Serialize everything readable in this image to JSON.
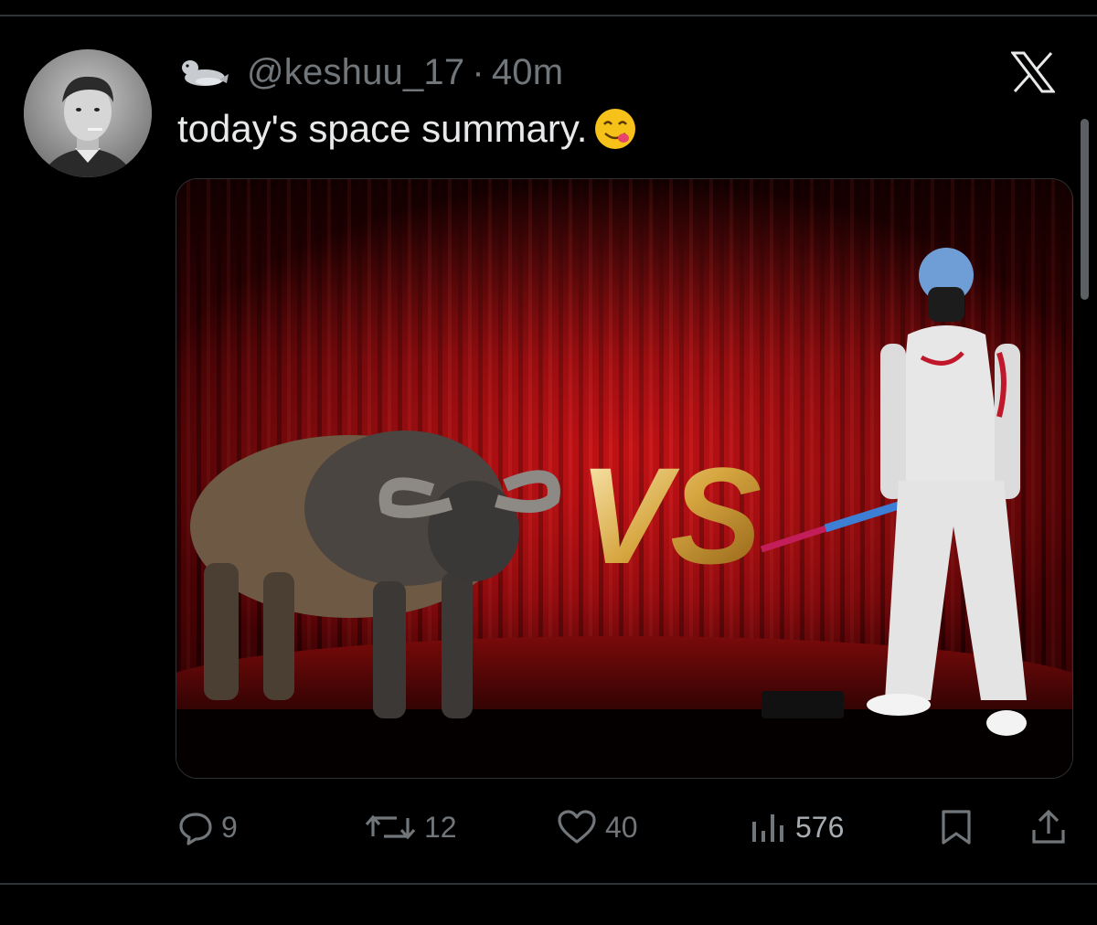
{
  "tweet": {
    "handle": "@keshuu_17",
    "separator": "·",
    "time": "40m",
    "text": "today's space summary.",
    "badge_icon": "seal-emoji-icon",
    "emoji_icon": "face-savoring-food-emoji-icon"
  },
  "media": {
    "vs_text": "VS"
  },
  "actions": {
    "replies": "9",
    "retweets": "12",
    "likes": "40",
    "views": "576"
  },
  "colors": {
    "background": "#000000",
    "text": "#e7e9ea",
    "secondary": "#71767b",
    "divider": "#2f3336",
    "curtain": "#b3060b"
  }
}
